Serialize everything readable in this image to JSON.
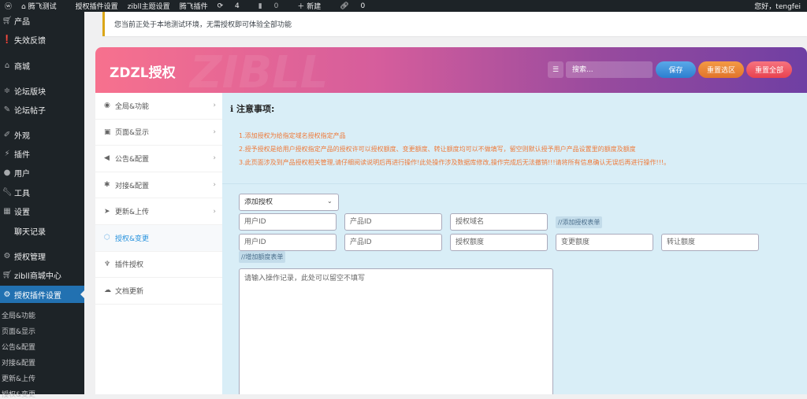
{
  "topbar": {
    "wp": "W",
    "site": "腾飞测试",
    "plugin_settings": "授权插件设置",
    "zibll": "zibll主题设置",
    "tengfei_plugin": "腾飞插件",
    "updates": "4",
    "comments": "0",
    "new": "新建",
    "links": "0",
    "greeting": "您好，tengfei"
  },
  "sidebar": {
    "items": [
      {
        "label": "产品",
        "icon": "cart"
      },
      {
        "label": "失效反馈",
        "icon": "alert"
      },
      {
        "label": "商城",
        "icon": "store"
      },
      {
        "label": "论坛版块",
        "icon": "forum"
      },
      {
        "label": "论坛帖子",
        "icon": "posts"
      },
      {
        "label": "外观",
        "icon": "brush"
      },
      {
        "label": "插件",
        "icon": "plugin"
      },
      {
        "label": "用户",
        "icon": "user"
      },
      {
        "label": "工具",
        "icon": "wrench"
      },
      {
        "label": "设置",
        "icon": "settings"
      },
      {
        "label": "聊天记录",
        "icon": ""
      },
      {
        "label": "授权管理",
        "icon": "gear"
      },
      {
        "label": "zibll商城中心",
        "icon": "cart"
      },
      {
        "label": "授权插件设置",
        "icon": "gear"
      }
    ],
    "submenu": [
      "全局&功能",
      "页面&显示",
      "公告&配置",
      "对接&配置",
      "更新&上传",
      "授权&变更"
    ]
  },
  "notice": "您当前正处于本地测试环境，无需授权即可体验全部功能",
  "panel": {
    "title": "ZDZL授权",
    "watermark": "ZIBLL",
    "search_placeholder": "搜索...",
    "save": "保存",
    "reset_section": "重置选区",
    "reset_all": "重置全部",
    "nav": [
      {
        "label": "全局&功能",
        "icon": "◉"
      },
      {
        "label": "页面&显示",
        "icon": "▣"
      },
      {
        "label": "公告&配置",
        "icon": "◀"
      },
      {
        "label": "对接&配置",
        "icon": "✱"
      },
      {
        "label": "更新&上传",
        "icon": "➤"
      },
      {
        "label": "授权&变更",
        "icon": "⬡"
      },
      {
        "label": "插件授权",
        "icon": "♆"
      },
      {
        "label": "文档更新",
        "icon": "☁"
      }
    ],
    "notes_title": "注意事项:",
    "notes": [
      "1.添加授权为给指定域名授权指定产品",
      "2.授予授权是给用户授权指定产品的授权许可以授权额度、变更额度、转让额度均可以不做填写，留空则默认授予用户产品设置里的额度及额度",
      "3.此页面涉及到产品授权相关管理,请仔细阅读说明后再进行操作!此处操作涉及数据库修改,操作完成后无法撤销!!!请将所有信息确认无误后再进行操作!!!。"
    ],
    "form": {
      "action": "添加授权",
      "row1": [
        "用户ID",
        "产品ID",
        "授权域名"
      ],
      "row1_tag": "//添加授权表单",
      "row2": [
        "用户ID",
        "产品ID",
        "授权额度",
        "变更额度",
        "转让额度"
      ],
      "row2_tag": "//增加额度表单",
      "log_placeholder": "请输入操作记录，此处可以留空不填写"
    }
  }
}
